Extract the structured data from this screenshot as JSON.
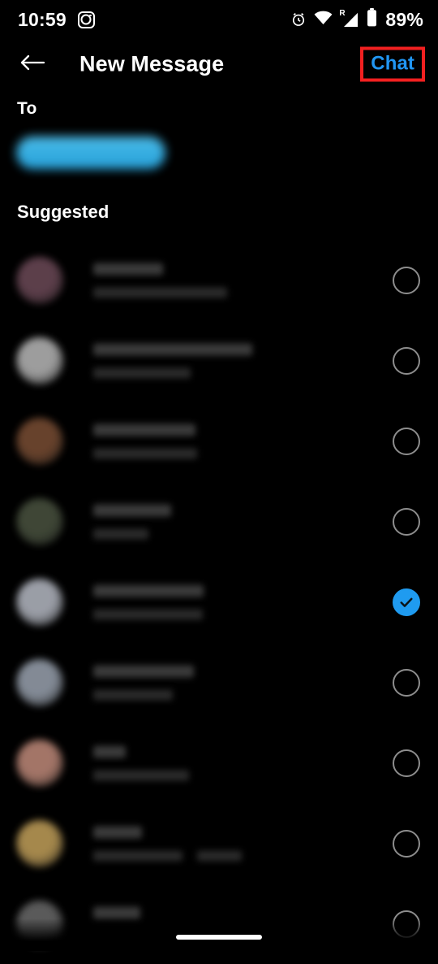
{
  "status_bar": {
    "time": "10:59",
    "app_icon": "instagram-icon",
    "alarm_icon": "alarm-clock-icon",
    "wifi_icon": "wifi-icon",
    "signal_icon": "cellular-signal-icon",
    "roaming_indicator": "R",
    "battery_icon": "battery-icon",
    "battery_percent": "89%"
  },
  "header": {
    "back_icon": "back-arrow-icon",
    "title": "New Message",
    "action_label": "Chat",
    "action_color": "#2196f3",
    "highlight_color": "#f22020"
  },
  "compose": {
    "to_label": "To",
    "recipient_chip": {
      "label": "",
      "blurred": true,
      "color": "#36b2e8"
    }
  },
  "section": {
    "suggested_label": "Suggested"
  },
  "list": {
    "selected_index": 4,
    "rows": [
      {
        "name": "",
        "username": "",
        "username2": "",
        "selected": false,
        "avatar_color": "#6d4a58",
        "name_w": 86,
        "user_w": 165
      },
      {
        "name": "",
        "username": "",
        "username2": "",
        "selected": false,
        "avatar_color": "#b9b9b9",
        "name_w": 196,
        "user_w": 120
      },
      {
        "name": "",
        "username": "",
        "username2": "",
        "selected": false,
        "avatar_color": "#7a4e34",
        "name_w": 126,
        "user_w": 128
      },
      {
        "name": "",
        "username": "",
        "username2": "",
        "selected": false,
        "avatar_color": "#4a5340",
        "name_w": 96,
        "user_w": 68
      },
      {
        "name": "",
        "username": "",
        "username2": "",
        "selected": true,
        "avatar_color": "#b6bac4",
        "name_w": 136,
        "user_w": 135
      },
      {
        "name": "",
        "username": "",
        "username2": "",
        "selected": false,
        "avatar_color": "#9aa3b0",
        "name_w": 124,
        "user_w": 98
      },
      {
        "name": "",
        "username": "",
        "username2": "",
        "selected": false,
        "avatar_color": "#c08a7a",
        "name_w": 40,
        "user_w": 118
      },
      {
        "name": "",
        "username": "",
        "username2": "",
        "selected": false,
        "avatar_color": "#c2a05a",
        "name_w": 60,
        "user_w": 110,
        "user2_w": 55
      },
      {
        "name": "",
        "username": "",
        "username2": "",
        "selected": false,
        "avatar_color": "#6a6a6a",
        "name_w": 58,
        "user_w": 0
      }
    ]
  },
  "system_nav": {
    "home_indicator": "home-indicator-bar"
  }
}
